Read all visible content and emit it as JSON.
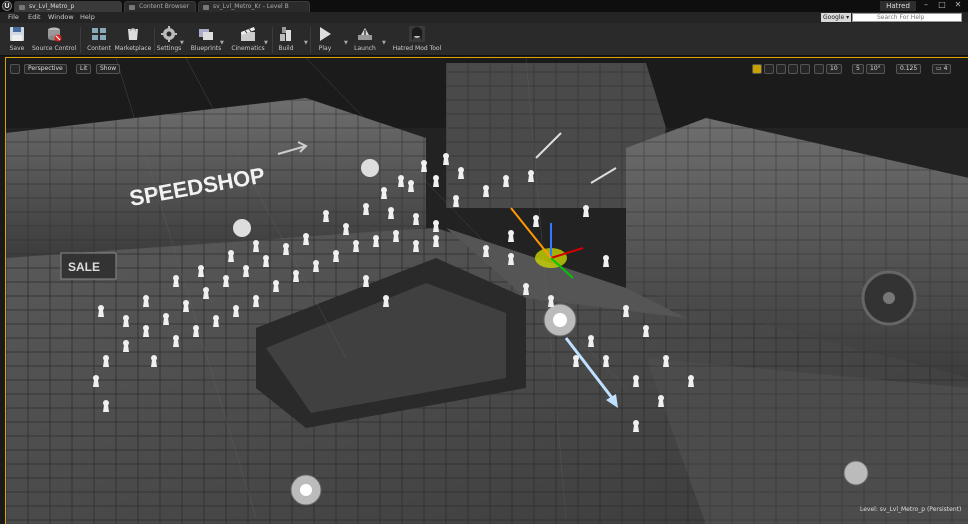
{
  "tabs": [
    {
      "label": "sv_Lvl_Metro_p",
      "active": true
    },
    {
      "label": "Content Browser",
      "active": false
    },
    {
      "label": "sv_Lvl_Metro_Kr - Level B",
      "active": false
    }
  ],
  "window": {
    "user_name": "Hatred",
    "minimize": "–",
    "maximize": "□",
    "close": "✕"
  },
  "menu": [
    "File",
    "Edit",
    "Window",
    "Help"
  ],
  "search": {
    "provider": "Google",
    "placeholder": "Search For Help"
  },
  "toolbar": [
    {
      "label": "Save",
      "icon": "save-icon"
    },
    {
      "label": "Source Control",
      "icon": "source-control-icon"
    },
    {
      "label": "Content",
      "icon": "content-icon"
    },
    {
      "label": "Marketplace",
      "icon": "marketplace-icon"
    },
    {
      "label": "Settings",
      "icon": "settings-icon"
    },
    {
      "label": "Blueprints",
      "icon": "blueprints-icon"
    },
    {
      "label": "Cinematics",
      "icon": "cinematics-icon"
    },
    {
      "label": "Build",
      "icon": "build-icon"
    },
    {
      "label": "Play",
      "icon": "play-icon"
    },
    {
      "label": "Launch",
      "icon": "launch-icon"
    },
    {
      "label": "Hatred Mod Tool",
      "icon": "hatred-mod-tool-icon"
    }
  ],
  "viewport": {
    "view_mode": "Perspective",
    "lighting": "Lit",
    "show": "Show",
    "snap_translate": "10",
    "snap_rotate": "10°",
    "snap_scale": "0.125",
    "grid": "5",
    "camera_speed": "4",
    "level_label": "Level:  sv_Lvl_Metro_p (Persistent)",
    "scene_signs": {
      "shop": "SPEEDSHOP",
      "sale": "SALE"
    },
    "accent_color": "#e0a000"
  }
}
